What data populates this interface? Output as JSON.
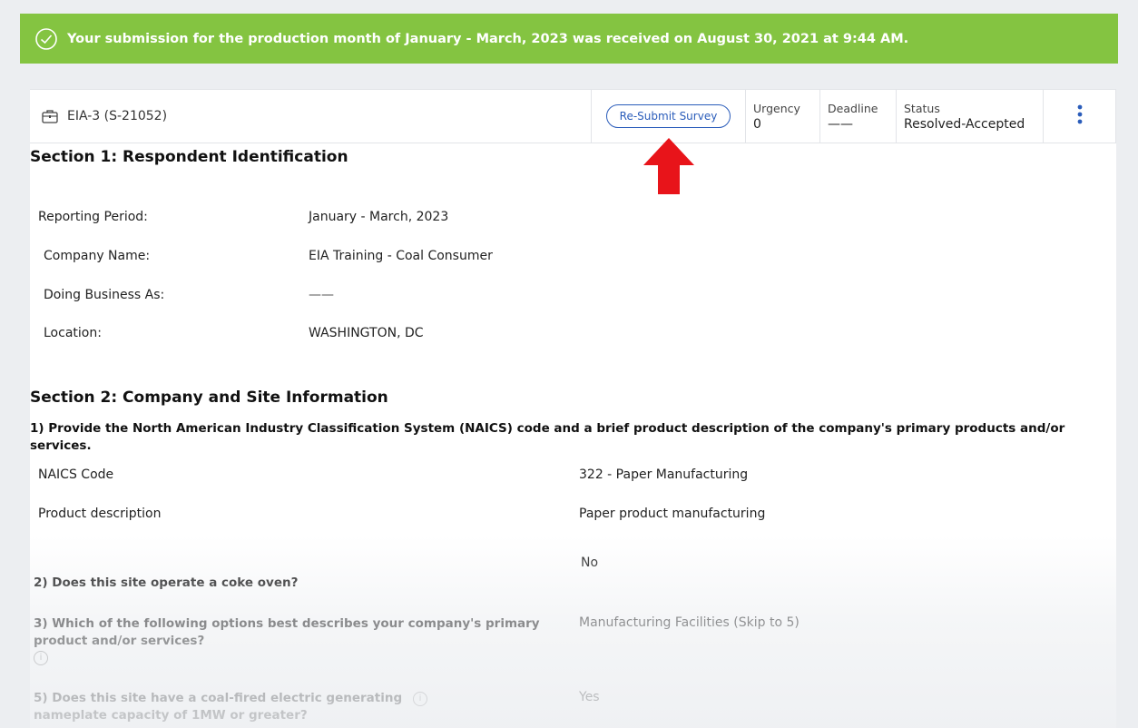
{
  "banner": {
    "text": "Your submission for the production month of January - March, 2023 was received on August 30, 2021 at 9:44 AM.",
    "color": "#84c441",
    "icon": "check-circle-icon"
  },
  "case_header": {
    "case_id": "EIA-3 (S-21052)",
    "case_icon": "briefcase-icon",
    "resubmit_label": "Re-Submit Survey",
    "urgency_label": "Urgency",
    "urgency_value": "0",
    "deadline_label": "Deadline",
    "deadline_value": "——",
    "status_label": "Status",
    "status_value": "Resolved-Accepted",
    "menu_icon": "more-vertical-icon"
  },
  "section1": {
    "title": "Section 1: Respondent Identification",
    "fields": [
      {
        "label": "Reporting Period:",
        "value": "January - March, 2023"
      },
      {
        "label": "Company Name:",
        "value": "EIA Training - Coal Consumer"
      },
      {
        "label": "Doing Business As:",
        "value": "——"
      },
      {
        "label": "Location:",
        "value": "WASHINGTON, DC"
      }
    ]
  },
  "section2": {
    "title": "Section 2: Company and Site Information",
    "q1": "1) Provide the North American Industry Classification System (NAICS) code and a brief product description of the company's primary products and/or services.",
    "naics_label": "NAICS Code",
    "naics_value": "322 - Paper Manufacturing",
    "product_label": "Product description",
    "product_value": "Paper product manufacturing",
    "q2": "2) Does this site operate a coke oven?",
    "q2_answer": "No",
    "q3": "3) Which of the following options best describes your company's primary product and/or services?",
    "q3_answer": "Manufacturing Facilities (Skip to 5)",
    "q5": "5) Does this site have a coal-fired electric generating nameplate capacity of 1MW or greater?",
    "q5_answer": "Yes"
  },
  "colors": {
    "accent": "#2a5cba",
    "arrow": "#e8141a"
  }
}
